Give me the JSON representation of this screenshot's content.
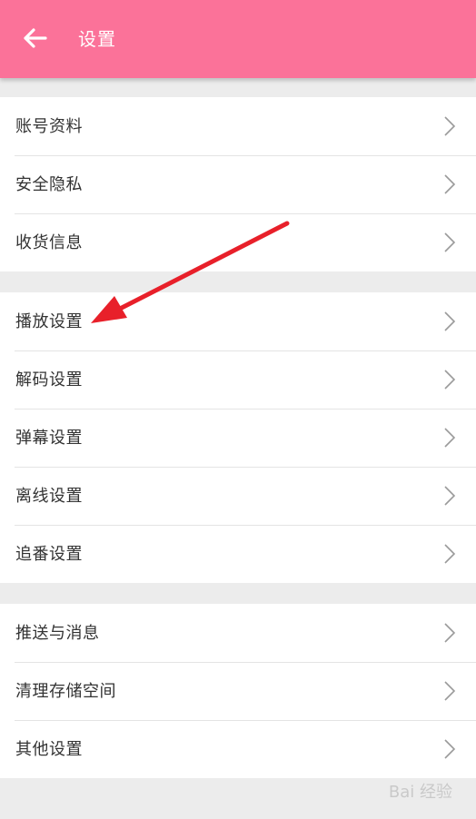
{
  "header": {
    "title": "设置",
    "back_icon": "arrow-left-icon",
    "background_color": "#fb7299"
  },
  "groups": [
    {
      "items": [
        {
          "label": "账号资料"
        },
        {
          "label": "安全隐私"
        },
        {
          "label": "收货信息"
        }
      ]
    },
    {
      "items": [
        {
          "label": "播放设置"
        },
        {
          "label": "解码设置"
        },
        {
          "label": "弹幕设置"
        },
        {
          "label": "离线设置"
        },
        {
          "label": "追番设置"
        }
      ]
    },
    {
      "items": [
        {
          "label": "推送与消息"
        },
        {
          "label": "清理存储空间"
        },
        {
          "label": "其他设置"
        }
      ]
    }
  ],
  "annotation": {
    "arrow_color": "#e8202a",
    "points_to": "播放设置"
  },
  "watermark": {
    "text": "Bai 经验"
  }
}
